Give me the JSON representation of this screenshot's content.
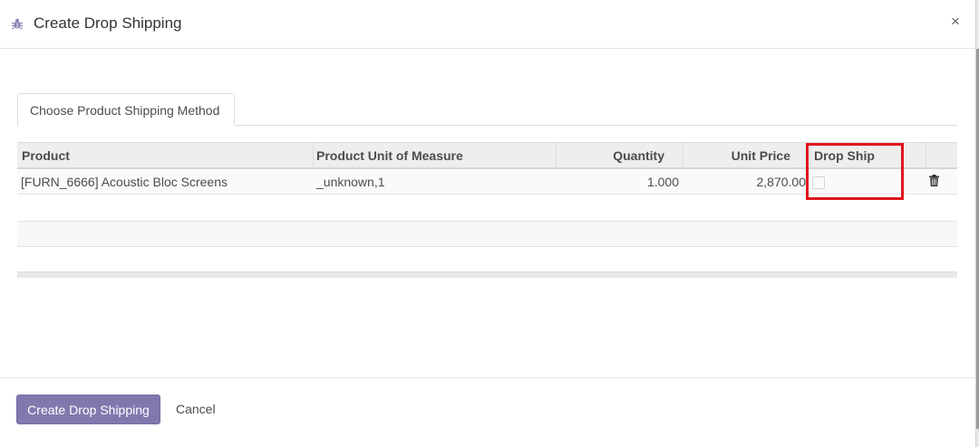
{
  "dialog": {
    "title": "Create Drop Shipping",
    "close_label": "×",
    "header_icon": "bug-icon"
  },
  "tabs": [
    {
      "label": "Choose Product Shipping Method"
    }
  ],
  "table": {
    "columns": [
      "Product",
      "Product Unit of Measure",
      "Quantity",
      "Unit Price",
      "Drop Ship"
    ],
    "rows": [
      {
        "product": "[FURN_6666] Acoustic Bloc Screens",
        "uom": "_unknown,1",
        "quantity": "1.000",
        "unit_price": "2,870.00",
        "drop_ship": false,
        "delete_icon": "trash-icon"
      }
    ]
  },
  "footer": {
    "primary_label": "Create Drop Shipping",
    "cancel_label": "Cancel"
  },
  "colors": {
    "primary": "#8079ae",
    "highlight": "#e0141e"
  }
}
